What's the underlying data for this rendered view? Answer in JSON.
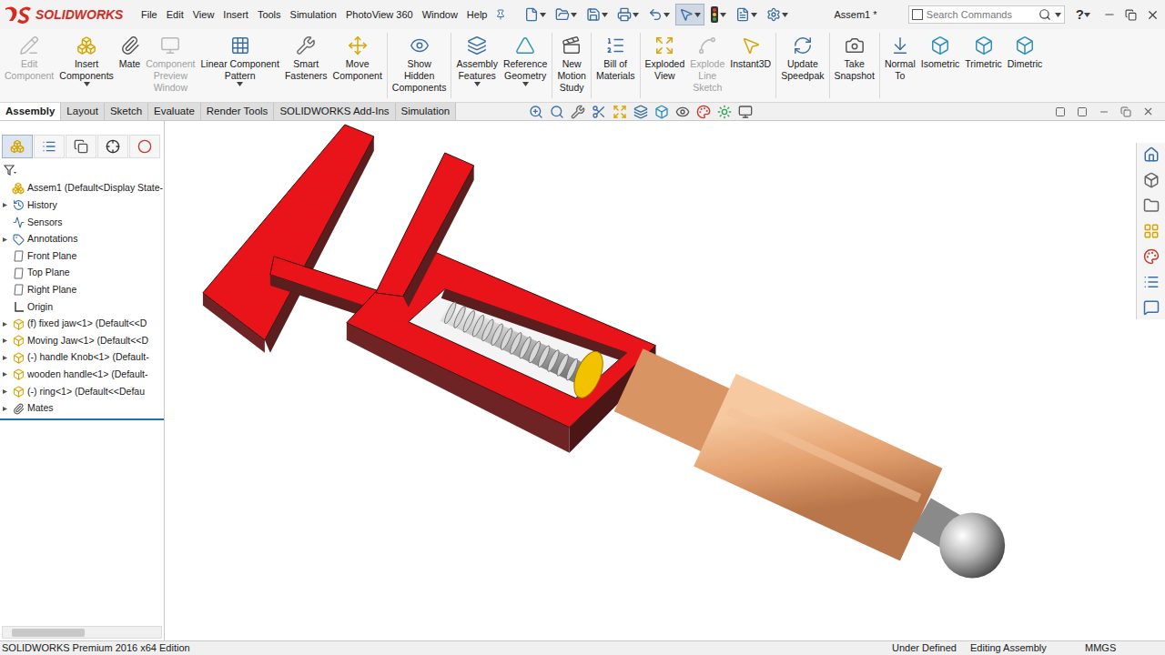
{
  "app": {
    "logo": "SOLIDWORKS"
  },
  "menu": [
    "File",
    "Edit",
    "View",
    "Insert",
    "Tools",
    "Simulation",
    "PhotoView 360",
    "Window",
    "Help"
  ],
  "quick_access": [
    {
      "selected": false
    },
    {
      "selected": false
    },
    {
      "selected": false
    },
    {
      "selected": false
    },
    {
      "selected": false
    },
    {
      "selected": true
    },
    {
      "selected": false
    },
    {
      "selected": false
    },
    {
      "selected": false
    }
  ],
  "window": {
    "title": "Assem1 *"
  },
  "search": {
    "placeholder": "Search Commands"
  },
  "help": "?",
  "ribbon": [
    {
      "items": [
        {
          "lines": [
            "Edit",
            "Component"
          ],
          "disabled": true,
          "dropdown": false
        },
        {
          "lines": [
            "Insert",
            "Components"
          ],
          "disabled": false,
          "dropdown": true
        },
        {
          "lines": [
            "Mate"
          ],
          "disabled": false,
          "dropdown": false
        },
        {
          "lines": [
            "Component",
            "Preview",
            "Window"
          ],
          "disabled": true,
          "dropdown": false
        },
        {
          "lines": [
            "Linear Component",
            "Pattern"
          ],
          "disabled": false,
          "dropdown": true
        },
        {
          "lines": [
            "Smart",
            "Fasteners"
          ],
          "disabled": false,
          "dropdown": false
        },
        {
          "lines": [
            "Move",
            "Component"
          ],
          "disabled": false,
          "dropdown": false
        }
      ]
    },
    {
      "items": [
        {
          "lines": [
            "Show",
            "Hidden",
            "Components"
          ],
          "disabled": false,
          "dropdown": false
        }
      ]
    },
    {
      "items": [
        {
          "lines": [
            "Assembly",
            "Features"
          ],
          "disabled": false,
          "dropdown": true
        },
        {
          "lines": [
            "Reference",
            "Geometry"
          ],
          "disabled": false,
          "dropdown": true
        }
      ]
    },
    {
      "items": [
        {
          "lines": [
            "New",
            "Motion",
            "Study"
          ],
          "disabled": false,
          "dropdown": false
        }
      ]
    },
    {
      "items": [
        {
          "lines": [
            "Bill of",
            "Materials"
          ],
          "disabled": false,
          "dropdown": false
        }
      ]
    },
    {
      "items": [
        {
          "lines": [
            "Exploded",
            "View"
          ],
          "disabled": false,
          "dropdown": false
        },
        {
          "lines": [
            "Explode",
            "Line",
            "Sketch"
          ],
          "disabled": true,
          "dropdown": false
        },
        {
          "lines": [
            "Instant3D"
          ],
          "disabled": false,
          "dropdown": false
        }
      ]
    },
    {
      "items": [
        {
          "lines": [
            "Update",
            "Speedpak"
          ],
          "disabled": false,
          "dropdown": false
        }
      ]
    },
    {
      "items": [
        {
          "lines": [
            "Take",
            "Snapshot"
          ],
          "disabled": false,
          "dropdown": false
        }
      ]
    },
    {
      "items": [
        {
          "lines": [
            "Normal",
            "To"
          ],
          "disabled": false,
          "dropdown": false
        },
        {
          "lines": [
            "Isometric"
          ],
          "disabled": false,
          "dropdown": false
        },
        {
          "lines": [
            "Trimetric"
          ],
          "disabled": false,
          "dropdown": false
        },
        {
          "lines": [
            "Dimetric"
          ],
          "disabled": false,
          "dropdown": false
        }
      ]
    }
  ],
  "tabs": [
    {
      "label": "Assembly",
      "selected": true
    },
    {
      "label": "Layout",
      "selected": false
    },
    {
      "label": "Sketch",
      "selected": false
    },
    {
      "label": "Evaluate",
      "selected": false
    },
    {
      "label": "Render Tools",
      "selected": false
    },
    {
      "label": "SOLIDWORKS Add-Ins",
      "selected": false
    },
    {
      "label": "Simulation",
      "selected": false
    }
  ],
  "panel_tabs": [
    {
      "selected": true
    },
    {
      "selected": false
    },
    {
      "selected": false
    },
    {
      "selected": false
    },
    {
      "selected": false
    }
  ],
  "tree": {
    "items": [
      {
        "label": "Assem1 (Default<Display State-",
        "kind": "assembly",
        "expandable": false
      },
      {
        "label": "History",
        "kind": "history",
        "expandable": true
      },
      {
        "label": "Sensors",
        "kind": "sensor",
        "expandable": false
      },
      {
        "label": "Annotations",
        "kind": "annotation",
        "expandable": true
      },
      {
        "label": "Front Plane",
        "kind": "plane",
        "expandable": false
      },
      {
        "label": "Top Plane",
        "kind": "plane",
        "expandable": false
      },
      {
        "label": "Right Plane",
        "kind": "plane",
        "expandable": false
      },
      {
        "label": "Origin",
        "kind": "origin",
        "expandable": false
      },
      {
        "label": "(f) fixed jaw<1> (Default<<D",
        "kind": "part",
        "expandable": true
      },
      {
        "label": "Moving Jaw<1> (Default<<D",
        "kind": "part",
        "expandable": true
      },
      {
        "label": "(-) handle Knob<1> (Default-",
        "kind": "part",
        "expandable": true
      },
      {
        "label": "wooden handle<1> (Default-",
        "kind": "part",
        "expandable": true
      },
      {
        "label": "(-) ring<1> (Default<<Defau",
        "kind": "part",
        "expandable": true
      },
      {
        "label": "Mates",
        "kind": "mates",
        "expandable": true
      }
    ]
  },
  "status_bar": {
    "edition": "SOLIDWORKS Premium 2016 x64 Edition",
    "state": "Under Defined",
    "mode": "Editing Assembly",
    "units": "MMGS"
  }
}
